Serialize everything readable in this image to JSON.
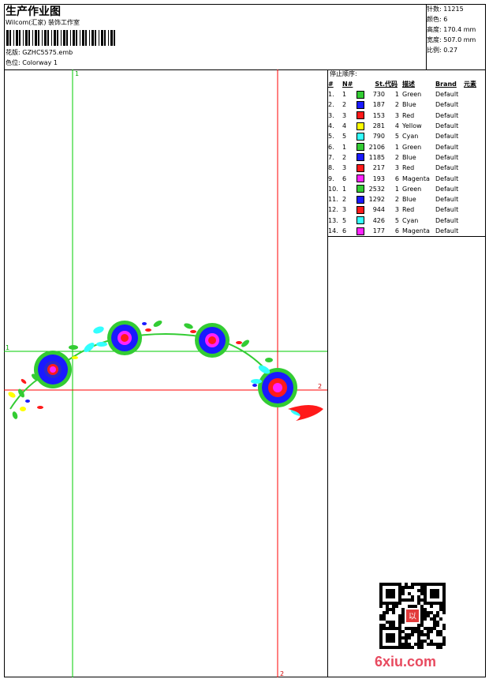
{
  "header": {
    "title": "生产作业图",
    "company": "Wilcom(汇家) 装饰工作室",
    "design_label": "花版:",
    "design_value": "GZHC5575.emb",
    "colorway_label": "色位:",
    "colorway_value": "Colorway 1"
  },
  "stats": [
    {
      "label": "针数:",
      "value": "11215"
    },
    {
      "label": "颜色:",
      "value": "6"
    },
    {
      "label": "高度:",
      "value": "170.4 mm"
    },
    {
      "label": "宽度:",
      "value": "507.0 mm"
    },
    {
      "label": "比例:",
      "value": "0.27"
    }
  ],
  "markers": {
    "green_v": "1",
    "green_h": "1",
    "red_h": "2",
    "red_v": "2"
  },
  "stop_sequence": {
    "header": "停止顺序:",
    "columns": [
      "#",
      "N#",
      "St.",
      "代码",
      "描述",
      "Brand",
      "元素"
    ],
    "rows": [
      {
        "n": "1.",
        "code": "1",
        "st": "730",
        "num": "1",
        "desc": "Green",
        "brand": "Default",
        "color": "#33cc33"
      },
      {
        "n": "2.",
        "code": "2",
        "st": "187",
        "num": "2",
        "desc": "Blue",
        "brand": "Default",
        "color": "#1a1aff"
      },
      {
        "n": "3.",
        "code": "3",
        "st": "153",
        "num": "3",
        "desc": "Red",
        "brand": "Default",
        "color": "#ff1a1a"
      },
      {
        "n": "4.",
        "code": "4",
        "st": "281",
        "num": "4",
        "desc": "Yellow",
        "brand": "Default",
        "color": "#ffff00"
      },
      {
        "n": "5.",
        "code": "5",
        "st": "790",
        "num": "5",
        "desc": "Cyan",
        "brand": "Default",
        "color": "#33ffff"
      },
      {
        "n": "6.",
        "code": "1",
        "st": "2106",
        "num": "1",
        "desc": "Green",
        "brand": "Default",
        "color": "#33cc33"
      },
      {
        "n": "7.",
        "code": "2",
        "st": "1185",
        "num": "2",
        "desc": "Blue",
        "brand": "Default",
        "color": "#1a1aff"
      },
      {
        "n": "8.",
        "code": "3",
        "st": "217",
        "num": "3",
        "desc": "Red",
        "brand": "Default",
        "color": "#ff1a1a"
      },
      {
        "n": "9.",
        "code": "6",
        "st": "193",
        "num": "6",
        "desc": "Magenta",
        "brand": "Default",
        "color": "#ff22ff"
      },
      {
        "n": "10.",
        "code": "1",
        "st": "2532",
        "num": "1",
        "desc": "Green",
        "brand": "Default",
        "color": "#33cc33"
      },
      {
        "n": "11.",
        "code": "2",
        "st": "1292",
        "num": "2",
        "desc": "Blue",
        "brand": "Default",
        "color": "#1a1aff"
      },
      {
        "n": "12.",
        "code": "3",
        "st": "944",
        "num": "3",
        "desc": "Red",
        "brand": "Default",
        "color": "#ff1a1a"
      },
      {
        "n": "13.",
        "code": "5",
        "st": "426",
        "num": "5",
        "desc": "Cyan",
        "brand": "Default",
        "color": "#33ffff"
      },
      {
        "n": "14.",
        "code": "6",
        "st": "177",
        "num": "6",
        "desc": "Magenta",
        "brand": "Default",
        "color": "#ff22ff"
      }
    ]
  },
  "watermark": "6xiu.com",
  "qr_seal": "以"
}
